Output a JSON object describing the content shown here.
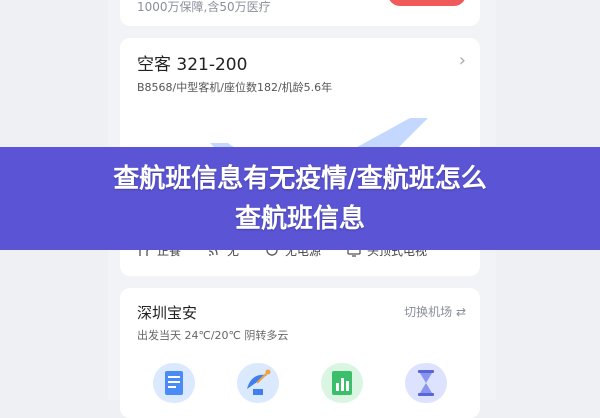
{
  "top_card": {
    "subtitle": "1000万保障,含50万医疗"
  },
  "aircraft": {
    "title": "空客 321-200",
    "meta": "B8568/中型客机/座位数182/机龄5.6年",
    "amenities": [
      {
        "label": "正餐",
        "icon": "meal-icon"
      },
      {
        "label": "无",
        "icon": "wifi-icon"
      },
      {
        "label": "无电源",
        "icon": "power-icon"
      },
      {
        "label": "头顶式电视",
        "icon": "tv-icon"
      }
    ]
  },
  "weather": {
    "city": "深圳宝安",
    "switch_label": "切换机场 ⇄",
    "line": "出发当天 24℃/20℃ 阴转多云"
  },
  "banner": {
    "line1": "查航班信息有无疫情/查航班怎么",
    "line2": "查航班信息"
  },
  "colors": {
    "banner": "#5b55d6",
    "accent_red": "#f15a5a",
    "plane": "#cfe0ff"
  }
}
